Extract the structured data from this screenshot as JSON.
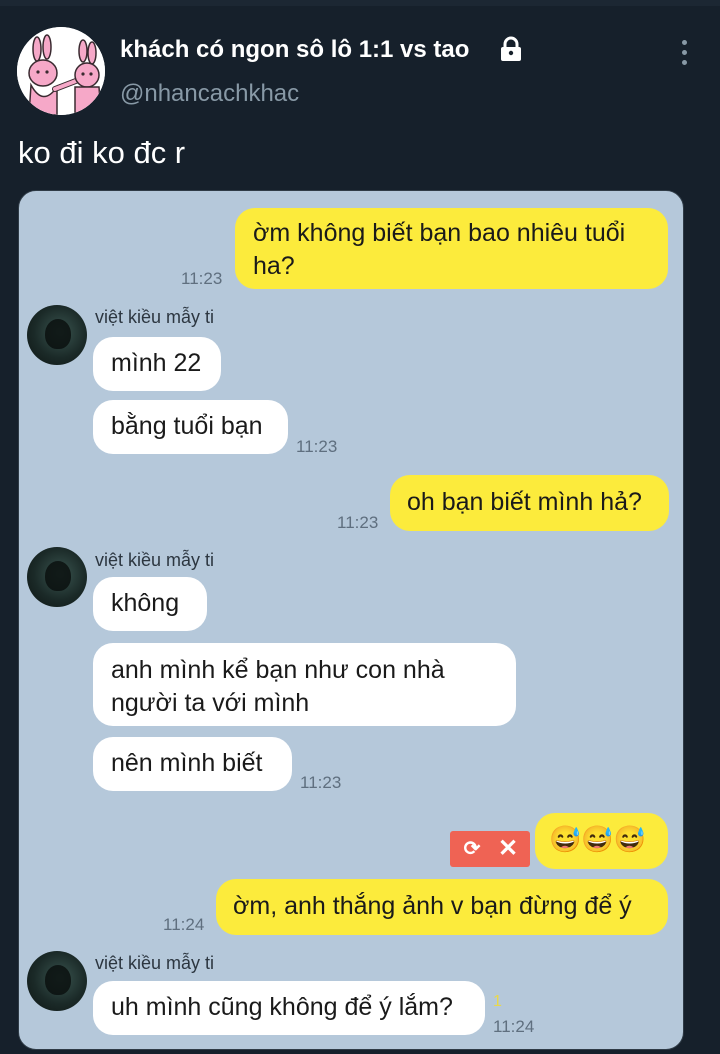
{
  "header": {
    "display_name": "khách có ngon sô lô 1:1 vs tao",
    "handle": "@nhancachkhac"
  },
  "tweet": {
    "text": "ko đi ko đc r"
  },
  "chat": {
    "sender_name": "việt kiều mẫy ti",
    "messages": [
      {
        "from": "me",
        "line1": "ờm không biết bạn bao nhiêu tuổi",
        "line2": "ha?",
        "time": "11:23"
      },
      {
        "from": "them",
        "text": "mình 22"
      },
      {
        "from": "them",
        "text": "bằng tuổi bạn",
        "time": "11:23"
      },
      {
        "from": "me",
        "text": "oh bạn biết mình hả?",
        "time": "11:23"
      },
      {
        "from": "them",
        "text": "không"
      },
      {
        "from": "them",
        "line1": "anh mình kể bạn như con nhà",
        "line2": "người ta với mình"
      },
      {
        "from": "them",
        "text": "nên mình biết",
        "time": "11:23"
      },
      {
        "from": "me",
        "text": "😅😅😅",
        "failed": true
      },
      {
        "from": "me",
        "text": "ờm, anh thắng ảnh v bạn đừng để ý",
        "time": "11:24"
      },
      {
        "from": "them",
        "text": "uh mình cũng không để ý lắm?",
        "time": "11:24",
        "read_count": "1"
      }
    ]
  },
  "colors": {
    "background": "#16202b",
    "chat_background": "#b5c8da",
    "outgoing_bubble": "#fceb3c",
    "incoming_bubble": "#ffffff",
    "retry_button": "#ef6354"
  }
}
